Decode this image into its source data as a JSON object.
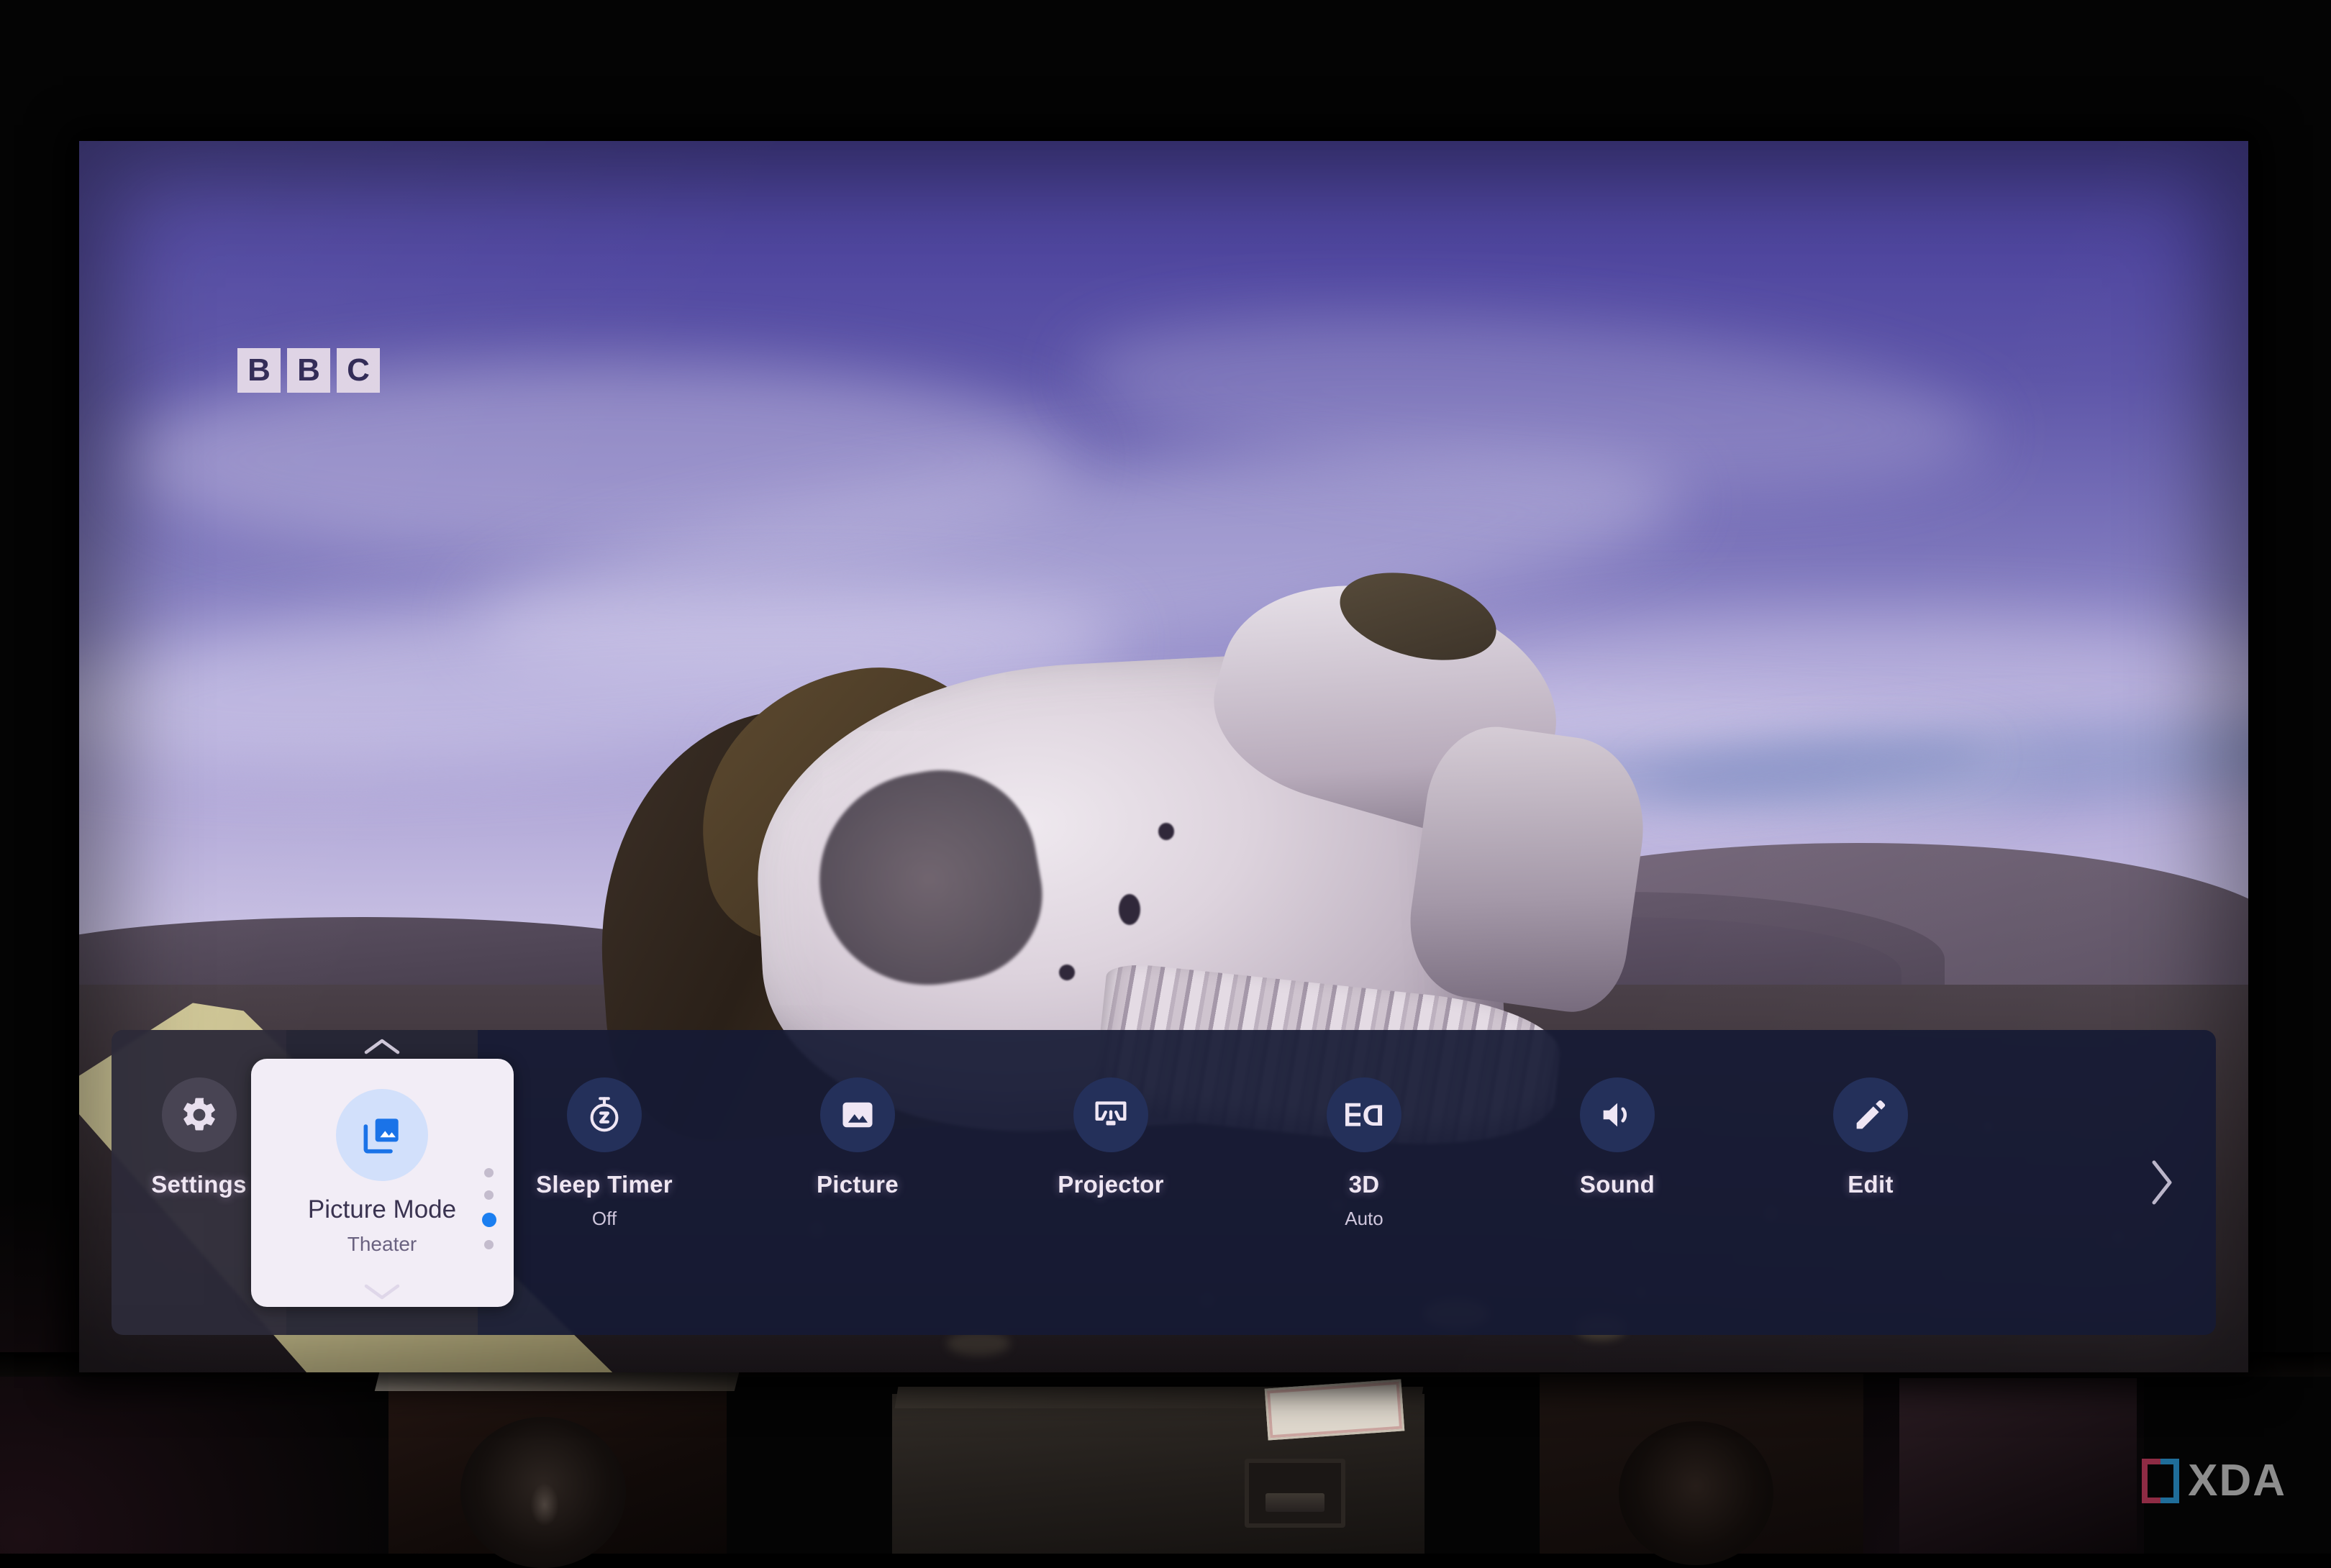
{
  "overlay": {
    "channel_logo": [
      "B",
      "B",
      "C"
    ]
  },
  "panel": {
    "items": [
      {
        "label": "Settings",
        "value": "",
        "icon": "gear-icon"
      },
      {
        "label": "Sleep Timer",
        "value": "Off",
        "icon": "sleep-timer-icon"
      },
      {
        "label": "Picture",
        "value": "",
        "icon": "picture-icon"
      },
      {
        "label": "Projector",
        "value": "",
        "icon": "projector-icon"
      },
      {
        "label": "3D",
        "value": "Auto",
        "icon": "3d-icon"
      },
      {
        "label": "Sound",
        "value": "",
        "icon": "speaker-icon"
      },
      {
        "label": "Edit",
        "value": "",
        "icon": "pencil-icon"
      }
    ],
    "focused_card": {
      "title": "Picture Mode",
      "value": "Theater",
      "icon": "picture-mode-icon",
      "dot_count": 4,
      "active_dot_index": 2,
      "chevron_up": "chevron-up-icon",
      "chevron_down": "chevron-down-icon"
    },
    "scroll_right": "chevron-right-icon",
    "colors": {
      "panel_bg": "#161a34",
      "icon_circle": "#24305a",
      "card_bg": "#f2edf6",
      "card_icon_bg": "#d2e0fb",
      "accent_blue": "#1b7ef0",
      "label_text": "#efe6f2"
    }
  },
  "watermark": {
    "text": "XDA",
    "bracket_left_color": "#8e2b44",
    "bracket_right_color": "#1f6d99"
  }
}
